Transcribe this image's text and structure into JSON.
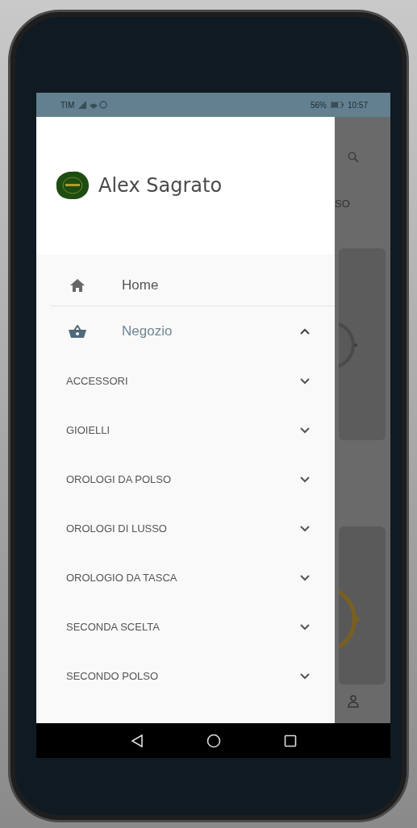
{
  "status_bar": {
    "carrier": "TIM",
    "battery": "56%",
    "time": "10:57"
  },
  "drawer": {
    "brand": "Alex Sagrato",
    "items": [
      {
        "kind": "link",
        "label": "Home"
      },
      {
        "kind": "group",
        "label": "Negozio",
        "expanded": true,
        "children": [
          {
            "label": "ACCESSORI",
            "expanded": false
          },
          {
            "label": "GIOIELLI",
            "expanded": false
          },
          {
            "label": "OROLOGI DA POLSO",
            "expanded": false
          },
          {
            "label": "OROLOGI DI LUSSO",
            "expanded": false
          },
          {
            "label": "OROLOGIO DA TASCA",
            "expanded": false
          },
          {
            "label": "SECONDA SCELTA",
            "expanded": false
          },
          {
            "label": "SECONDO POLSO",
            "expanded": false
          }
        ]
      }
    ]
  },
  "background": {
    "heading_fragment": "SO"
  }
}
